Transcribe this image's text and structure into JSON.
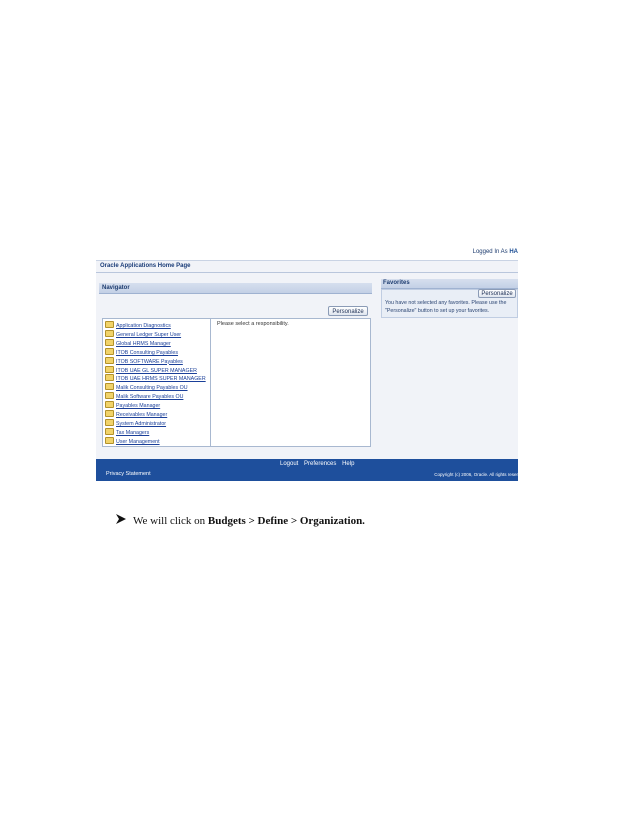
{
  "header": {
    "logged_in": "Logged In As",
    "user": "HA",
    "page_title": "Oracle Applications Home Page"
  },
  "navigator": {
    "title": "Navigator",
    "personalize_label": "Personalize",
    "responsibilities": [
      "Application Diagnostics",
      "General Ledger Super User",
      "Global HRMS Manager",
      "ITOB Consulting Payables",
      "ITOB SOFTWARE Payables",
      "ITOB UAE GL SUPER MANAGER",
      "ITOB UAE HRMS SUPER MANAGER",
      "Malik Consulting Payables OU",
      "Malik Software Payables OU",
      "Payables Manager",
      "Receivables Manager",
      "System Administrator",
      "Tax Managers",
      "User Management"
    ],
    "message": "Please select a responsibility."
  },
  "favorites": {
    "title": "Favorites",
    "personalize_label": "Personalize",
    "message": "You have not selected any favorites. Please use the \"Personalize\" button to set up your favorites."
  },
  "footer": {
    "links": [
      "Logout",
      "Preferences",
      "Help"
    ],
    "privacy": "Privacy Statement",
    "copyright": "Copyright (c) 2006, Oracle. All rights reser"
  },
  "instruction": {
    "prefix": "We will click on",
    "path": "Budgets > Define > Organization."
  },
  "colors": {
    "footer_bg": "#1e4f9c",
    "link": "#1a3f99",
    "header_bg": "#c3d0e6"
  }
}
